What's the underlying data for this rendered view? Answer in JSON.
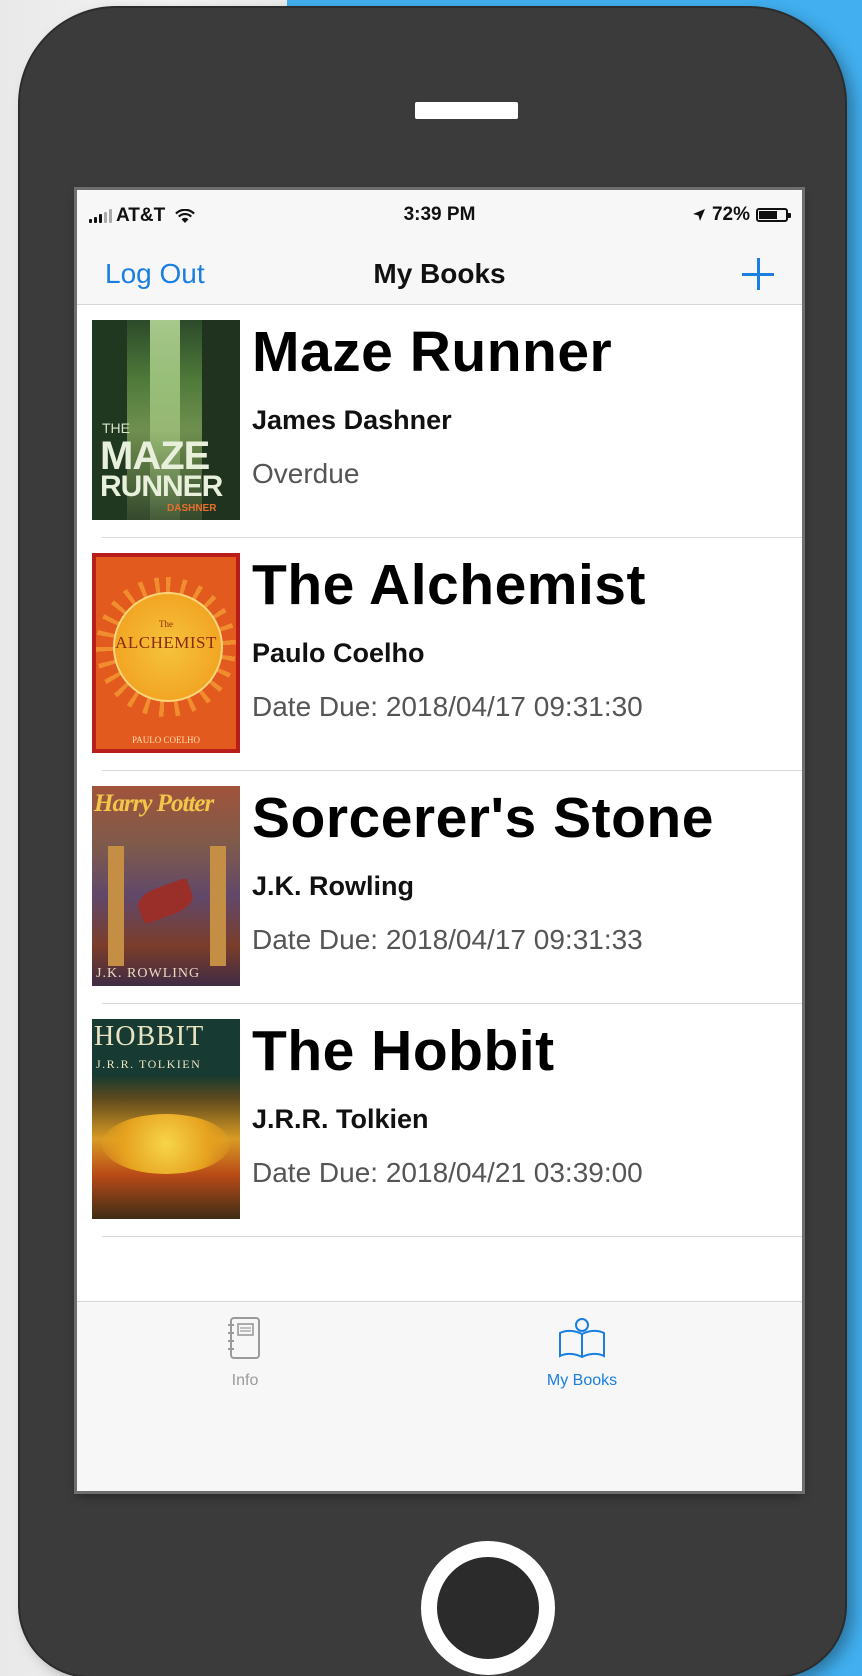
{
  "status_bar": {
    "carrier": "AT&T",
    "time": "3:39 PM",
    "battery_percent": "72%",
    "battery_level": 0.72,
    "signal_bars": 3,
    "signal_max": 5,
    "icons": [
      "signal-icon",
      "wifi-icon",
      "location-arrow-icon",
      "battery-icon"
    ]
  },
  "nav": {
    "left_button": "Log Out",
    "title": "My Books",
    "add_icon": "plus-icon"
  },
  "books": [
    {
      "title": "Maze Runner",
      "author": "James Dashner",
      "status": "Overdue",
      "cover_text": {
        "line1": "THE",
        "line2": "MAZE",
        "line3": "RUNNER",
        "line4": "DASHNER"
      }
    },
    {
      "title": "The Alchemist",
      "author": "Paulo Coelho",
      "status": "Date Due: 2018/04/17 09:31:30",
      "cover_text": {
        "line1": "The",
        "line2": "ALCHEMIST",
        "line3": "PAULO COELHO"
      }
    },
    {
      "title": "Sorcerer's Stone",
      "author": "J.K. Rowling",
      "status": "Date Due: 2018/04/17 09:31:33",
      "cover_text": {
        "line1": "Harry Potter",
        "line2": "J.K. ROWLING"
      }
    },
    {
      "title": "The Hobbit",
      "author": "J.R.R. Tolkien",
      "status": "Date Due: 2018/04/21 03:39:00",
      "cover_text": {
        "line1": "HOBBIT",
        "line2": "J.R.R. TOLKIEN"
      }
    }
  ],
  "tab_bar": {
    "tabs": [
      {
        "label": "Info",
        "icon": "notebook-icon",
        "selected": false
      },
      {
        "label": "My Books",
        "icon": "open-book-icon",
        "selected": true
      }
    ]
  },
  "colors": {
    "accent": "#1a7fe0",
    "phone_body": "#3b3b3b",
    "background_right": "#41aff0"
  }
}
